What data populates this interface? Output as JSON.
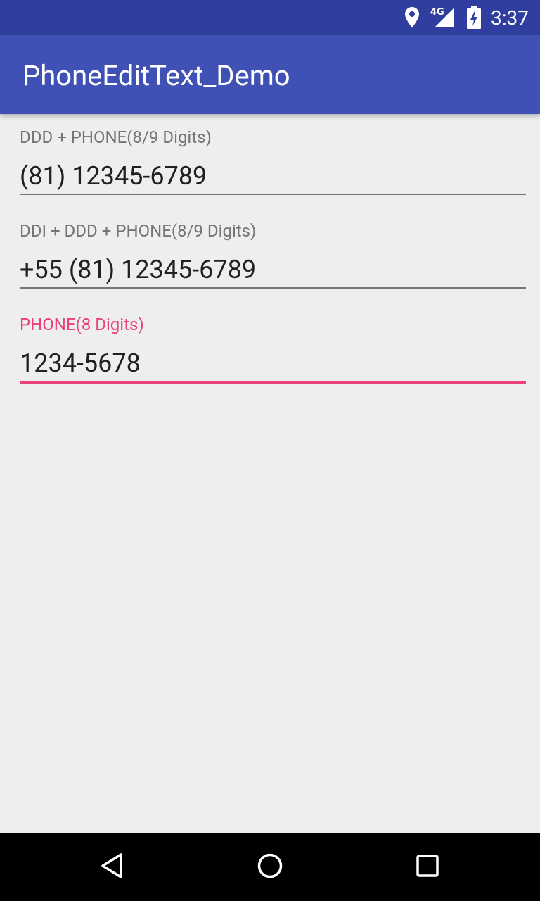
{
  "status_bar": {
    "time": "3:37",
    "network_label": "4G",
    "icons": [
      "location-icon",
      "cellular-signal-icon",
      "battery-charging-icon"
    ]
  },
  "app_bar": {
    "title": "PhoneEditText_Demo"
  },
  "fields": [
    {
      "label": "DDD + PHONE(8/9 Digits)",
      "value": "(81) 12345-6789",
      "focused": false
    },
    {
      "label": "DDI + DDD + PHONE(8/9 Digits)",
      "value": "+55 (81) 12345-6789",
      "focused": false
    },
    {
      "label": "PHONE(8 Digits)",
      "value": "1234-5678",
      "focused": true
    }
  ],
  "nav_bar": {
    "icons": [
      "back-icon",
      "home-icon",
      "recents-icon"
    ]
  },
  "colors": {
    "status_bar": "#303f9f",
    "app_bar": "#3f51b5",
    "accent": "#ec407a",
    "background": "#eeeeee",
    "text_primary": "#212121",
    "text_secondary": "#757575"
  }
}
